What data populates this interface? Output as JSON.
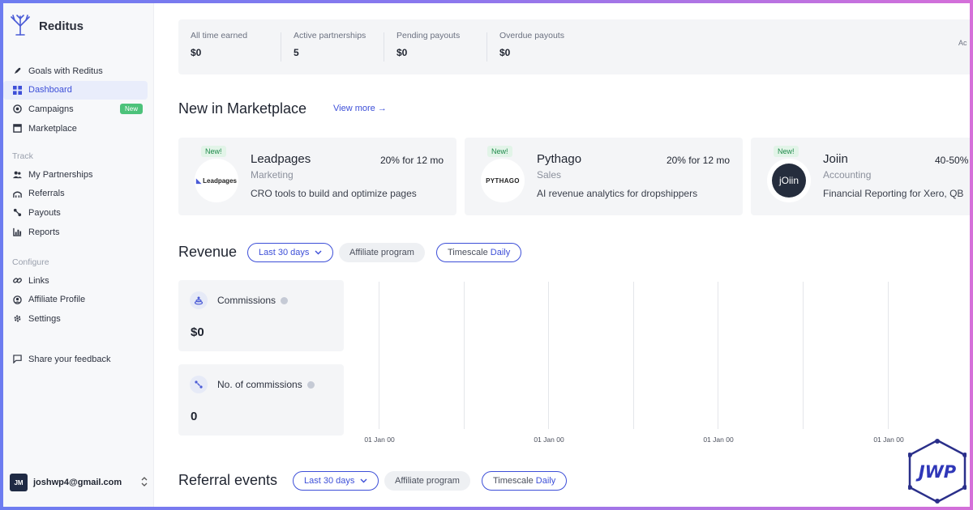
{
  "brand": {
    "name": "Reditus"
  },
  "nav": {
    "main": [
      {
        "label": "Goals with Reditus",
        "icon": "rocket-icon"
      },
      {
        "label": "Dashboard",
        "icon": "grid-icon",
        "active": true
      },
      {
        "label": "Campaigns",
        "icon": "target-icon",
        "badge": "New"
      },
      {
        "label": "Marketplace",
        "icon": "store-icon"
      }
    ],
    "track_label": "Track",
    "track": [
      {
        "label": "My Partnerships",
        "icon": "users-icon"
      },
      {
        "label": "Referrals",
        "icon": "referrals-icon"
      },
      {
        "label": "Payouts",
        "icon": "payouts-icon"
      },
      {
        "label": "Reports",
        "icon": "chart-icon"
      }
    ],
    "configure_label": "Configure",
    "configure": [
      {
        "label": "Links",
        "icon": "link-icon"
      },
      {
        "label": "Affiliate Profile",
        "icon": "profile-icon"
      },
      {
        "label": "Settings",
        "icon": "gear-icon"
      }
    ],
    "feedback": {
      "label": "Share your feedback",
      "icon": "chat-icon"
    }
  },
  "user": {
    "initials": "JM",
    "email": "joshwp4@gmail.com"
  },
  "stats": [
    {
      "label": "All time earned",
      "value": "$0"
    },
    {
      "label": "Active partnerships",
      "value": "5"
    },
    {
      "label": "Pending payouts",
      "value": "$0"
    },
    {
      "label": "Overdue payouts",
      "value": "$0"
    }
  ],
  "stats_cut_label": "Ac",
  "marketplace": {
    "title": "New in Marketplace",
    "view_more": "View more →",
    "cards": [
      {
        "badge": "New!",
        "logo_text": "Leadpages",
        "name": "Leadpages",
        "category": "Marketing",
        "rate": "20% for 12 mo",
        "description": "CRO tools to build and optimize pages"
      },
      {
        "badge": "New!",
        "logo_text": "PYTHAGO",
        "name": "Pythago",
        "category": "Sales",
        "rate": "20% for 12 mo",
        "description": "AI revenue analytics for dropshippers"
      },
      {
        "badge": "New!",
        "logo_text": "jOiin",
        "name": "Joiin",
        "category": "Accounting",
        "rate": "40-50%",
        "description": "Financial Reporting for Xero, QB"
      }
    ]
  },
  "revenue": {
    "title": "Revenue",
    "filter_range": "Last 30 days",
    "filter_program": "Affiliate program",
    "timescale_prefix": "Timescale",
    "timescale_value": "Daily",
    "commissions_label": "Commissions",
    "commissions_value": "$0",
    "count_label": "No. of commissions",
    "count_value": "0"
  },
  "chart_data": {
    "type": "line",
    "x": [
      "01 Jan 00",
      "01 Jan 00",
      "01 Jan 00",
      "01 Jan 00"
    ],
    "series": [],
    "title": "",
    "xlabel": "",
    "ylabel": "",
    "grid": true
  },
  "referral_events": {
    "title": "Referral events",
    "filter_range": "Last 30 days",
    "filter_program": "Affiliate program",
    "timescale_prefix": "Timescale",
    "timescale_value": "Daily"
  },
  "watermark": {
    "text": "JWP"
  }
}
